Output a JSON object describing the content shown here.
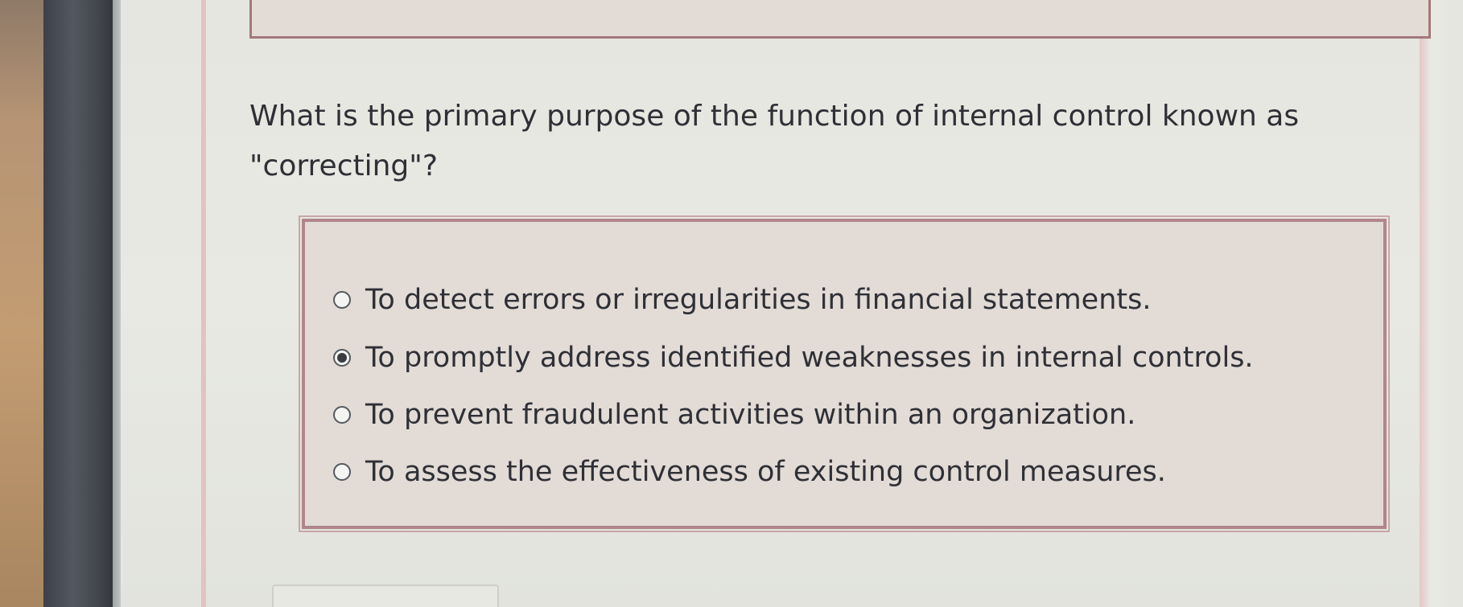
{
  "question": {
    "line1": "What is the primary purpose of the function of internal control known as",
    "line2": "\"correcting\"?"
  },
  "options": [
    {
      "label": "To detect errors or irregularities in financial statements.",
      "selected": false
    },
    {
      "label": "To promptly address identified weaknesses in internal controls.",
      "selected": true
    },
    {
      "label": "To prevent fraudulent activities within an organization.",
      "selected": false
    },
    {
      "label": "To assess the effectiveness of existing control measures.",
      "selected": false
    }
  ],
  "colors": {
    "text": "#2f3036",
    "box_border": "#b0868a",
    "box_background": "#e2dbd6",
    "page_background": "#e8e9e3"
  }
}
